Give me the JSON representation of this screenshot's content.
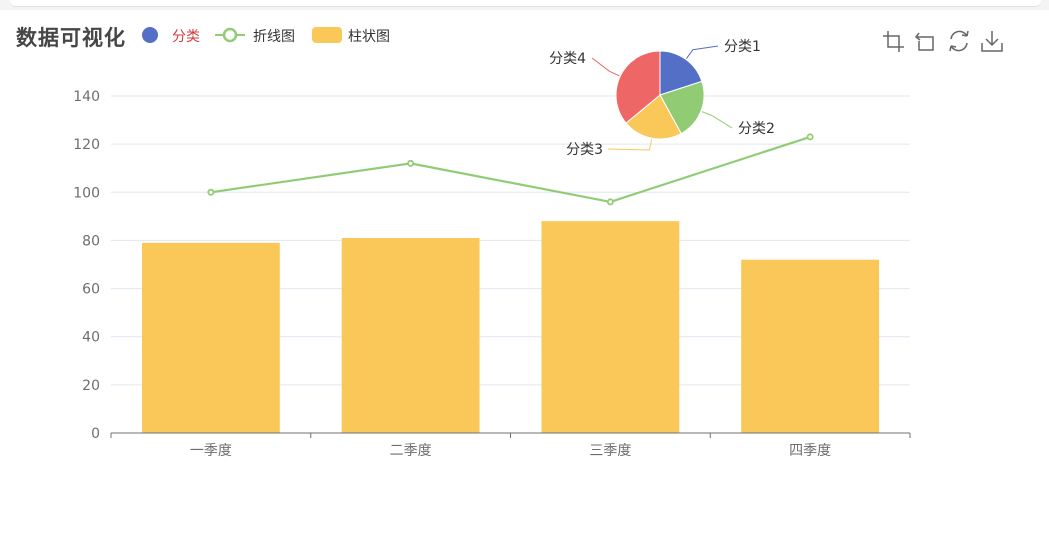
{
  "title": "数据可视化",
  "legend": [
    {
      "name": "分类",
      "symbol": "circle",
      "color": "#5470c6",
      "active": true
    },
    {
      "name": "折线图",
      "symbol": "line-circle",
      "color": "#91cc75",
      "active": false
    },
    {
      "name": "柱状图",
      "symbol": "rect",
      "color": "#fac858",
      "active": false
    }
  ],
  "toolbox": [
    {
      "name": "zoom-icon"
    },
    {
      "name": "zoom-back-icon"
    },
    {
      "name": "restore-icon"
    },
    {
      "name": "download-icon"
    }
  ],
  "chart_data": [
    {
      "type": "bar",
      "categories": [
        "一季度",
        "二季度",
        "三季度",
        "四季度"
      ],
      "series": [
        {
          "name": "柱状图",
          "type": "bar",
          "color": "#fac858",
          "values": [
            79,
            81,
            88,
            72
          ]
        },
        {
          "name": "折线图",
          "type": "line",
          "color": "#91cc75",
          "values": [
            100,
            112,
            96,
            123
          ]
        }
      ],
      "ylim": [
        0,
        140
      ],
      "yticks": [
        0,
        20,
        40,
        60,
        80,
        100,
        120,
        140
      ],
      "grid": true,
      "legend_position": "top-left"
    },
    {
      "type": "pie",
      "series": [
        {
          "name": "分类1",
          "value": 20,
          "color": "#5470c6"
        },
        {
          "name": "分类2",
          "value": 22,
          "color": "#91cc75"
        },
        {
          "name": "分类3",
          "value": 22,
          "color": "#fac858"
        },
        {
          "name": "分类4",
          "value": 36,
          "color": "#ee6666"
        }
      ],
      "position": "top-right"
    }
  ]
}
